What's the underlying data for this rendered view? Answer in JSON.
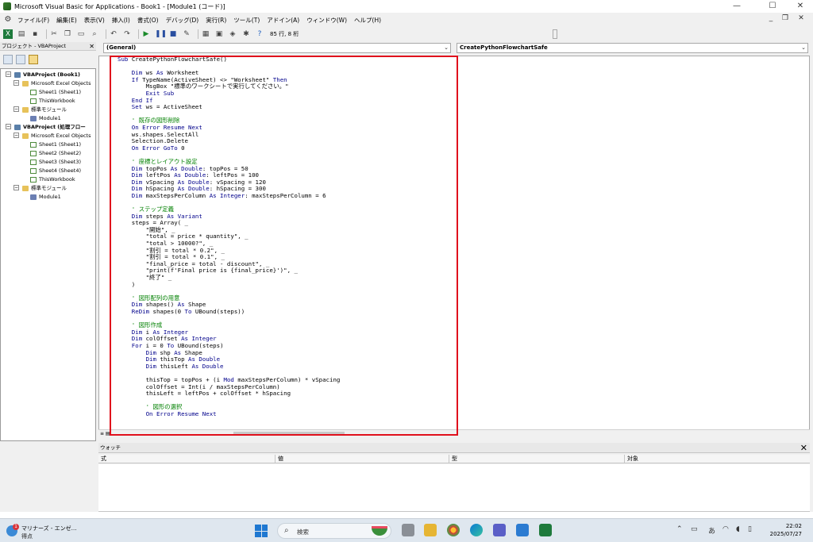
{
  "window": {
    "title": "Microsoft Visual Basic for Applications - Book1 - [Module1 (コード)]",
    "minimize": "—",
    "maximize": "☐",
    "close": "✕"
  },
  "menu": {
    "items": [
      "ファイル(F)",
      "編集(E)",
      "表示(V)",
      "挿入(I)",
      "書式(O)",
      "デバッグ(D)",
      "実行(R)",
      "ツール(T)",
      "アドイン(A)",
      "ウィンドウ(W)",
      "ヘルプ(H)"
    ],
    "mdi_minimize": "_",
    "mdi_restore": "❐",
    "mdi_close": "✕"
  },
  "toolbar": {
    "position": "85 行, 8 桁",
    "icons": [
      "excel-icon",
      "insert-module-icon",
      "save-icon",
      "cut-icon",
      "copy-icon",
      "paste-icon",
      "find-icon",
      "undo-icon",
      "redo-icon",
      "run-icon",
      "break-icon",
      "reset-icon",
      "design-mode-icon",
      "project-explorer-icon",
      "properties-icon",
      "object-browser-icon",
      "toolbox-icon",
      "help-icon"
    ]
  },
  "project": {
    "header": "プロジェクト - VBAProject",
    "close": "✕",
    "tree": [
      {
        "label": "VBAProject (Book1)",
        "level": 0,
        "icon": "proj",
        "bold": true,
        "expander": "−"
      },
      {
        "label": "Microsoft Excel Objects",
        "level": 1,
        "icon": "folder",
        "bold": false,
        "expander": "−"
      },
      {
        "label": "Sheet1 (Sheet1)",
        "level": 2,
        "icon": "sheet",
        "bold": false
      },
      {
        "label": "ThisWorkbook",
        "level": 2,
        "icon": "sheet",
        "bold": false
      },
      {
        "label": "標準モジュール",
        "level": 1,
        "icon": "folder",
        "bold": false,
        "expander": "−"
      },
      {
        "label": "Module1",
        "level": 2,
        "icon": "mod",
        "bold": false
      },
      {
        "label": "VBAProject (処理フロー",
        "level": 0,
        "icon": "proj",
        "bold": true,
        "expander": "−"
      },
      {
        "label": "Microsoft Excel Objects",
        "level": 1,
        "icon": "folder",
        "bold": false,
        "expander": "−"
      },
      {
        "label": "Sheet1 (Sheet1)",
        "level": 2,
        "icon": "sheet",
        "bold": false
      },
      {
        "label": "Sheet2 (Sheet2)",
        "level": 2,
        "icon": "sheet",
        "bold": false
      },
      {
        "label": "Sheet3 (Sheet3)",
        "level": 2,
        "icon": "sheet",
        "bold": false
      },
      {
        "label": "Sheet4 (Sheet4)",
        "level": 2,
        "icon": "sheet",
        "bold": false
      },
      {
        "label": "ThisWorkbook",
        "level": 2,
        "icon": "sheet",
        "bold": false
      },
      {
        "label": "標準モジュール",
        "level": 1,
        "icon": "folder",
        "bold": false,
        "expander": "−"
      },
      {
        "label": "Module1",
        "level": 2,
        "icon": "mod",
        "bold": false
      }
    ]
  },
  "code": {
    "object_combo": "(General)",
    "procedure_combo": "CreatePythonFlowchartSafe",
    "lines": [
      [
        [
          "kw",
          "Sub "
        ],
        [
          "tx",
          "CreatePythonFlowchartSafe()"
        ]
      ],
      [
        [
          "tx",
          ""
        ]
      ],
      [
        [
          "kw",
          "    Dim "
        ],
        [
          "tx",
          "ws "
        ],
        [
          "kw",
          "As "
        ],
        [
          "tx",
          "Worksheet"
        ]
      ],
      [
        [
          "kw",
          "    If "
        ],
        [
          "tx",
          "TypeName(ActiveSheet) <> \"Worksheet\" "
        ],
        [
          "kw",
          "Then"
        ]
      ],
      [
        [
          "tx",
          "        MsgBox \"標準のワークシートで実行してください。\""
        ]
      ],
      [
        [
          "kw",
          "        Exit Sub"
        ]
      ],
      [
        [
          "kw",
          "    End If"
        ]
      ],
      [
        [
          "kw",
          "    Set "
        ],
        [
          "tx",
          "ws = ActiveSheet"
        ]
      ],
      [
        [
          "tx",
          ""
        ]
      ],
      [
        [
          "cm",
          "    ' 既存の図形削除"
        ]
      ],
      [
        [
          "kw",
          "    On Error Resume Next"
        ]
      ],
      [
        [
          "tx",
          "    ws.shapes.SelectAll"
        ]
      ],
      [
        [
          "tx",
          "    Selection.Delete"
        ]
      ],
      [
        [
          "kw",
          "    On Error GoTo "
        ],
        [
          "tx",
          "0"
        ]
      ],
      [
        [
          "tx",
          ""
        ]
      ],
      [
        [
          "cm",
          "    ' 座標とレイアウト設定"
        ]
      ],
      [
        [
          "kw",
          "    Dim "
        ],
        [
          "tx",
          "topPos "
        ],
        [
          "kw",
          "As Double"
        ],
        [
          "tx",
          ": topPos = 50"
        ]
      ],
      [
        [
          "kw",
          "    Dim "
        ],
        [
          "tx",
          "leftPos "
        ],
        [
          "kw",
          "As Double"
        ],
        [
          "tx",
          ": leftPos = 100"
        ]
      ],
      [
        [
          "kw",
          "    Dim "
        ],
        [
          "tx",
          "vSpacing "
        ],
        [
          "kw",
          "As Double"
        ],
        [
          "tx",
          ": vSpacing = 120"
        ]
      ],
      [
        [
          "kw",
          "    Dim "
        ],
        [
          "tx",
          "hSpacing "
        ],
        [
          "kw",
          "As Double"
        ],
        [
          "tx",
          ": hSpacing = 300"
        ]
      ],
      [
        [
          "kw",
          "    Dim "
        ],
        [
          "tx",
          "maxStepsPerColumn "
        ],
        [
          "kw",
          "As Integer"
        ],
        [
          "tx",
          ": maxStepsPerColumn = 6"
        ]
      ],
      [
        [
          "tx",
          ""
        ]
      ],
      [
        [
          "cm",
          "    ' ステップ定義"
        ]
      ],
      [
        [
          "kw",
          "    Dim "
        ],
        [
          "tx",
          "steps "
        ],
        [
          "kw",
          "As Variant"
        ]
      ],
      [
        [
          "tx",
          "    steps = Array( _"
        ]
      ],
      [
        [
          "tx",
          "        \"開始\", _"
        ]
      ],
      [
        [
          "tx",
          "        \"total = price * quantity\", _"
        ]
      ],
      [
        [
          "tx",
          "        \"total > 10000?\", _"
        ]
      ],
      [
        [
          "tx",
          "        \"割引 = total * 0.2\", _"
        ]
      ],
      [
        [
          "tx",
          "        \"割引 = total * 0.1\", _"
        ]
      ],
      [
        [
          "tx",
          "        \"final_price = total - discount\", _"
        ]
      ],
      [
        [
          "tx",
          "        \"print(f'Final price is {final_price}')\", _"
        ]
      ],
      [
        [
          "tx",
          "        \"終了\" _"
        ]
      ],
      [
        [
          "tx",
          "    )"
        ]
      ],
      [
        [
          "tx",
          ""
        ]
      ],
      [
        [
          "cm",
          "    ' 図形配列の用意"
        ]
      ],
      [
        [
          "kw",
          "    Dim "
        ],
        [
          "tx",
          "shapes() "
        ],
        [
          "kw",
          "As "
        ],
        [
          "tx",
          "Shape"
        ]
      ],
      [
        [
          "kw",
          "    ReDim "
        ],
        [
          "tx",
          "shapes(0 "
        ],
        [
          "kw",
          "To "
        ],
        [
          "tx",
          "UBound(steps))"
        ]
      ],
      [
        [
          "tx",
          ""
        ]
      ],
      [
        [
          "cm",
          "    ' 図形作成"
        ]
      ],
      [
        [
          "kw",
          "    Dim "
        ],
        [
          "tx",
          "i "
        ],
        [
          "kw",
          "As Integer"
        ]
      ],
      [
        [
          "kw",
          "    Dim "
        ],
        [
          "tx",
          "colOffset "
        ],
        [
          "kw",
          "As Integer"
        ]
      ],
      [
        [
          "kw",
          "    For "
        ],
        [
          "tx",
          "i = 0 "
        ],
        [
          "kw",
          "To "
        ],
        [
          "tx",
          "UBound(steps)"
        ]
      ],
      [
        [
          "kw",
          "        Dim "
        ],
        [
          "tx",
          "shp "
        ],
        [
          "kw",
          "As "
        ],
        [
          "tx",
          "Shape"
        ]
      ],
      [
        [
          "kw",
          "        Dim "
        ],
        [
          "tx",
          "thisTop "
        ],
        [
          "kw",
          "As Double"
        ]
      ],
      [
        [
          "kw",
          "        Dim "
        ],
        [
          "tx",
          "thisLeft "
        ],
        [
          "kw",
          "As Double"
        ]
      ],
      [
        [
          "tx",
          ""
        ]
      ],
      [
        [
          "tx",
          "        thisTop = topPos + (i "
        ],
        [
          "kw",
          "Mod "
        ],
        [
          "tx",
          "maxStepsPerColumn) * vSpacing"
        ]
      ],
      [
        [
          "tx",
          "        colOffset = Int(i / maxStepsPerColumn)"
        ]
      ],
      [
        [
          "tx",
          "        thisLeft = leftPos + colOffset * hSpacing"
        ]
      ],
      [
        [
          "tx",
          ""
        ]
      ],
      [
        [
          "cm",
          "        ' 図形の選択"
        ]
      ],
      [
        [
          "kw",
          "        On Error Resume Next"
        ]
      ]
    ]
  },
  "watch": {
    "title": "ウォッチ",
    "close": "✕",
    "columns": [
      "式",
      "値",
      "型",
      "対象"
    ]
  },
  "taskbar": {
    "weather_line1": "マリナーズ - エンゼ…",
    "weather_line2": "得点",
    "notification_count": "1",
    "search_placeholder": "検索",
    "ime": "あ",
    "time": "22:02",
    "date": "2025/07/27"
  }
}
